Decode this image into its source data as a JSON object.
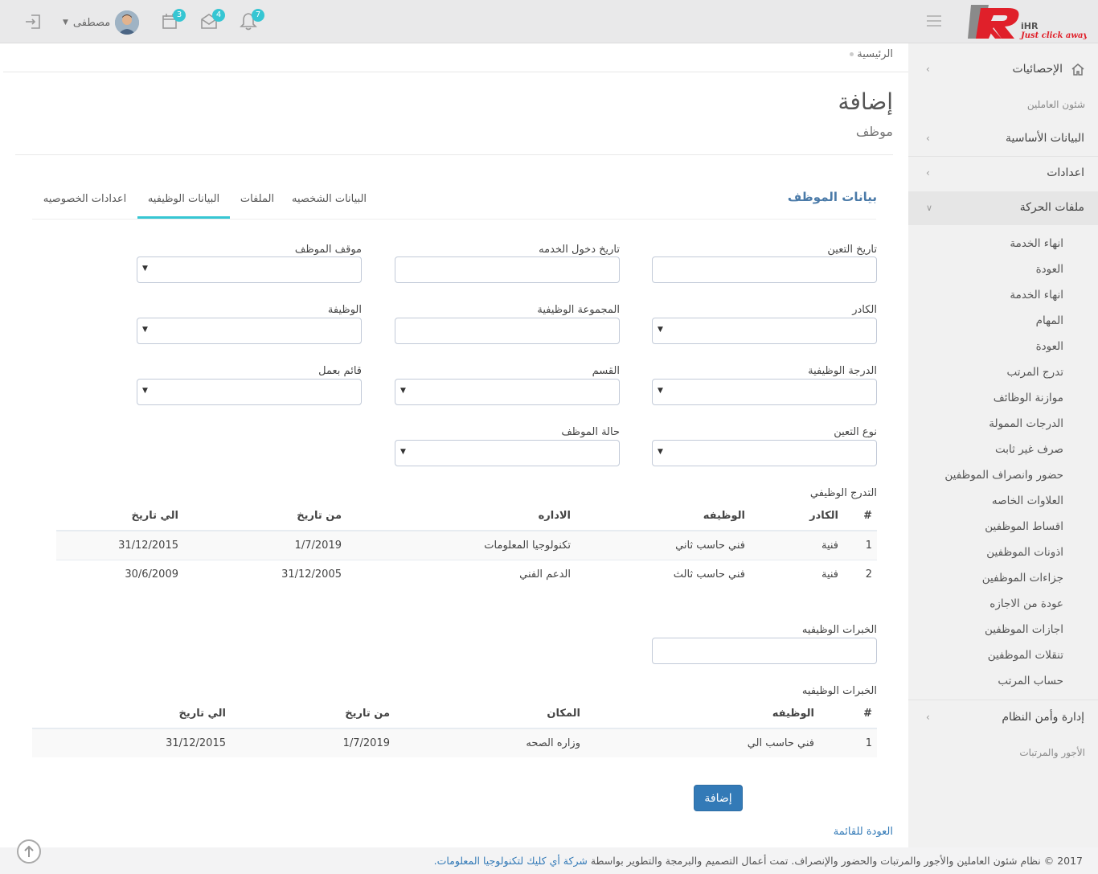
{
  "header": {
    "logo_text": "iHR",
    "logo_tagline": "Just click away",
    "user_name": "مصطفى",
    "notifications_count": "7",
    "messages_count": "4",
    "tasks_count": "3"
  },
  "sidebar": {
    "statistics": "الإحصائيات",
    "section_hr": "شئون العاملين",
    "basic_data": "البيانات الأساسية",
    "settings": "اعدادات",
    "movement_files": "ملفات الحركة",
    "sub_items": [
      "انهاء الخدمة",
      "العودة",
      "انهاء الخدمة",
      "المهام",
      "العودة",
      "تدرج المرتب",
      "موازنة الوظائف",
      "الدرجات الممولة",
      "صرف غير ثابت",
      "حضور وانصراف الموظفين",
      "العلاوات الخاصه",
      "اقساط الموظفين",
      "اذونات الموظفين",
      "جزاءات الموظفين",
      "عودة من الاجازه",
      "اجازات الموظفين",
      "تنقلات الموظفين",
      "حساب المرتب"
    ],
    "system_admin": "إدارة وأمن النظام",
    "section_payroll": "الأجور والمرتبات"
  },
  "breadcrumb": {
    "home": "الرئيسية"
  },
  "page": {
    "title": "إضافة",
    "subtitle": "موظف"
  },
  "panel": {
    "title": "بيانات الموظف",
    "tabs": [
      "البيانات الشخصيه",
      "الملفات",
      "البيانات الوظيفيه",
      "اعدادات الخصوصيه"
    ]
  },
  "form": {
    "appointment_date": "تاريخ التعين",
    "service_entry_date": "تاريخ دخول الخدمه",
    "employee_position": "موقف الموظف",
    "cadre": "الكادر",
    "job_group": "المجموعة الوظيفية",
    "job": "الوظيفة",
    "job_grade": "الدرجة الوظيفية",
    "department": "القسم",
    "acting": "قائم بعمل",
    "appointment_type": "نوع التعين",
    "employee_status": "حالة الموظف"
  },
  "career_table": {
    "label": "التدرج الوظيفي",
    "headers": [
      "#",
      "الكادر",
      "الوظيفه",
      "الاداره",
      "من تاريخ",
      "الي تاريخ"
    ],
    "rows": [
      [
        "1",
        "فنية",
        "فني حاسب ثاني",
        "تكنولوجيا المعلومات",
        "1/7/2019",
        "31/12/2015"
      ],
      [
        "2",
        "فنية",
        "فني حاسب ثالث",
        "الدعم الفني",
        "31/12/2005",
        "30/6/2009"
      ]
    ]
  },
  "experience_field": {
    "label": "الخبرات الوظيفيه"
  },
  "experience_table": {
    "label": "الخبرات الوظيفيه",
    "headers": [
      "#",
      "الوظيفه",
      "المكان",
      "من تاريخ",
      "الي تاريخ"
    ],
    "rows": [
      [
        "1",
        "فني حاسب الي",
        "وزاره الصحه",
        "1/7/2019",
        "31/12/2015"
      ]
    ]
  },
  "actions": {
    "add": "إضافة",
    "back": "العودة للقائمة"
  },
  "footer": {
    "text": "2017 © نظام شئون العاملين والأجور والمرتبات والحضور والإنصراف. تمت أعمال التصميم والبرمجة والتطوير بواسطة",
    "company": "شركة أي كليك لتكنولوجيا المعلومات."
  },
  "colors": {
    "accent": "#36c6d3",
    "primary": "#337ab7",
    "logo_red": "#e0202a"
  }
}
